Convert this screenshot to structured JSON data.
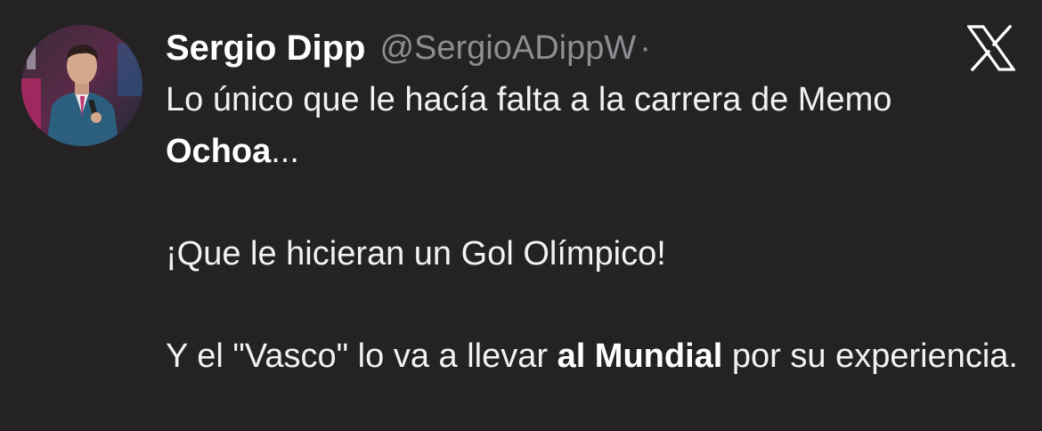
{
  "tweet": {
    "author_name": "Sergio Dipp",
    "handle": "@SergioADippW",
    "separator": "·",
    "platform_icon": "x-logo-icon",
    "paragraphs": {
      "p1": {
        "text_before": "Lo único que le hacía falta a la carrera de Memo ",
        "bold": "Ochoa",
        "text_after": "..."
      },
      "p2": {
        "text": "¡Que le hicieran un Gol Olímpico!"
      },
      "p3": {
        "text_before": "Y el \"Vasco\" lo va a llevar ",
        "bold": "al Mundial",
        "text_after": " por su experiencia."
      }
    }
  },
  "colors": {
    "background": "#252224",
    "text": "#f2f2f2",
    "handle": "#8d8d92"
  }
}
